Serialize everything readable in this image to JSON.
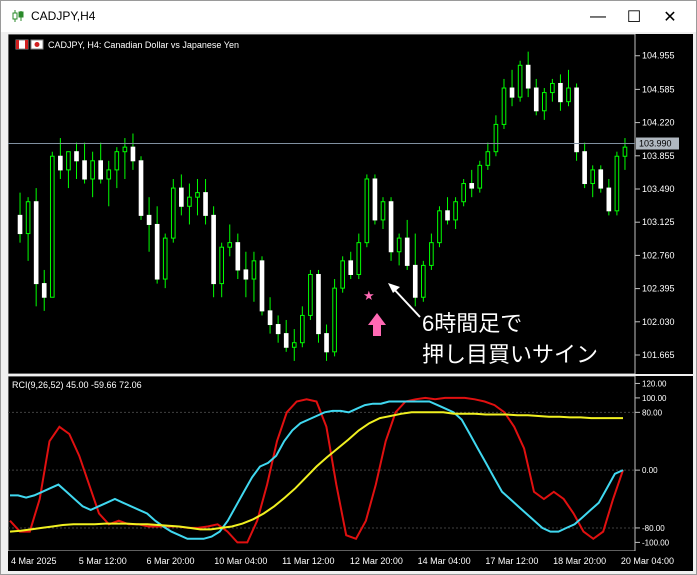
{
  "window": {
    "title": "CADJPY,H4",
    "buttons": {
      "minimize": "—",
      "maximize": "☐",
      "close": "✕"
    }
  },
  "main_chart": {
    "header": "CADJPY, H4:  Canadian Dollar vs Japanese Yen",
    "current_price": "103.990",
    "price_ticks": [
      "104.955",
      "104.585",
      "104.220",
      "103.855",
      "103.490",
      "103.125",
      "102.760",
      "102.395",
      "102.030",
      "101.665"
    ],
    "annotation_line1": "6時間足で",
    "annotation_line2": "押し目買いサイン",
    "marker_star": "★",
    "colors": {
      "candle_up": "#ffffff",
      "candle_down": "#ffffff",
      "wick": "#00ff00",
      "star": "#ff69b4",
      "arrow": "#ff69b4",
      "annotation_text": "#ffffff"
    }
  },
  "indicator": {
    "header": "RCI(9,26,52) 45.00 -59.66 72.06",
    "ticks": [
      "120.00",
      "100.00",
      "80.00",
      "0.00",
      "-80.00",
      "-100.00"
    ],
    "colors": {
      "short": "#e01010",
      "mid": "#40d8f0",
      "long": "#f0f020"
    }
  },
  "time_axis": {
    "labels": [
      "4 Mar 2025",
      "5 Mar 12:00",
      "6 Mar 20:00",
      "10 Mar 04:00",
      "11 Mar 12:00",
      "12 Mar 20:00",
      "14 Mar 04:00",
      "17 Mar 12:00",
      "18 Mar 20:00",
      "20 Mar 04:00"
    ]
  },
  "chart_data": [
    {
      "type": "candlestick",
      "title": "CADJPY, H4:  Canadian Dollar vs Japanese Yen",
      "ylim": [
        101.5,
        105.15
      ],
      "y_ticks": [
        104.955,
        104.585,
        104.22,
        103.855,
        103.49,
        103.125,
        102.76,
        102.395,
        102.03,
        101.665
      ],
      "current_price": 103.99,
      "ohlc": [
        [
          103.2,
          103.45,
          102.9,
          103.0
        ],
        [
          103.0,
          103.4,
          102.7,
          103.35
        ],
        [
          103.35,
          103.5,
          102.2,
          102.45
        ],
        [
          102.45,
          102.6,
          102.15,
          102.3
        ],
        [
          102.3,
          103.9,
          102.3,
          103.85
        ],
        [
          103.85,
          104.05,
          103.6,
          103.7
        ],
        [
          103.7,
          103.9,
          103.5,
          103.9
        ],
        [
          103.9,
          104.0,
          103.6,
          103.8
        ],
        [
          103.8,
          104.0,
          103.55,
          103.6
        ],
        [
          103.6,
          103.9,
          103.4,
          103.8
        ],
        [
          103.8,
          104.0,
          103.55,
          103.6
        ],
        [
          103.6,
          103.8,
          103.3,
          103.7
        ],
        [
          103.7,
          103.95,
          103.5,
          103.9
        ],
        [
          103.9,
          104.05,
          103.6,
          103.95
        ],
        [
          103.95,
          104.1,
          103.7,
          103.8
        ],
        [
          103.8,
          103.85,
          103.15,
          103.2
        ],
        [
          103.2,
          103.4,
          102.8,
          103.1
        ],
        [
          103.1,
          103.3,
          102.45,
          102.5
        ],
        [
          102.5,
          103.0,
          102.4,
          102.95
        ],
        [
          102.95,
          103.6,
          102.9,
          103.5
        ],
        [
          103.5,
          103.65,
          103.2,
          103.3
        ],
        [
          103.3,
          103.55,
          103.1,
          103.4
        ],
        [
          103.4,
          103.6,
          103.2,
          103.45
        ],
        [
          103.45,
          103.6,
          103.1,
          103.2
        ],
        [
          103.2,
          103.3,
          102.3,
          102.45
        ],
        [
          102.45,
          102.9,
          102.3,
          102.85
        ],
        [
          102.85,
          103.1,
          102.75,
          102.9
        ],
        [
          102.9,
          103.0,
          102.5,
          102.6
        ],
        [
          102.6,
          102.8,
          102.3,
          102.5
        ],
        [
          102.5,
          102.8,
          102.25,
          102.7
        ],
        [
          102.7,
          102.75,
          102.1,
          102.15
        ],
        [
          102.15,
          102.3,
          101.9,
          102.0
        ],
        [
          102.0,
          102.1,
          101.8,
          101.9
        ],
        [
          101.9,
          102.05,
          101.7,
          101.75
        ],
        [
          101.75,
          101.95,
          101.6,
          101.8
        ],
        [
          101.8,
          102.2,
          101.75,
          102.1
        ],
        [
          102.1,
          102.6,
          102.05,
          102.55
        ],
        [
          102.55,
          102.6,
          101.8,
          101.9
        ],
        [
          101.9,
          102.0,
          101.6,
          101.7
        ],
        [
          101.7,
          102.5,
          101.65,
          102.4
        ],
        [
          102.4,
          102.75,
          102.35,
          102.7
        ],
        [
          102.7,
          102.8,
          102.5,
          102.55
        ],
        [
          102.55,
          103.0,
          102.5,
          102.9
        ],
        [
          102.9,
          103.65,
          102.85,
          103.6
        ],
        [
          103.6,
          103.65,
          103.1,
          103.15
        ],
        [
          103.15,
          103.4,
          103.05,
          103.35
        ],
        [
          103.35,
          103.4,
          102.7,
          102.8
        ],
        [
          102.8,
          103.0,
          102.65,
          102.95
        ],
        [
          102.95,
          103.15,
          102.6,
          102.65
        ],
        [
          102.65,
          103.0,
          102.2,
          102.3
        ],
        [
          102.3,
          102.7,
          102.25,
          102.65
        ],
        [
          102.65,
          103.0,
          102.6,
          102.9
        ],
        [
          102.9,
          103.3,
          102.85,
          103.25
        ],
        [
          103.25,
          103.4,
          103.1,
          103.15
        ],
        [
          103.15,
          103.4,
          103.05,
          103.35
        ],
        [
          103.35,
          103.6,
          103.3,
          103.55
        ],
        [
          103.55,
          103.7,
          103.4,
          103.5
        ],
        [
          103.5,
          103.8,
          103.45,
          103.75
        ],
        [
          103.75,
          104.0,
          103.7,
          103.9
        ],
        [
          103.9,
          104.3,
          103.85,
          104.2
        ],
        [
          104.2,
          104.7,
          104.15,
          104.6
        ],
        [
          104.6,
          104.8,
          104.4,
          104.5
        ],
        [
          104.5,
          104.9,
          104.45,
          104.85
        ],
        [
          104.85,
          105.0,
          104.5,
          104.6
        ],
        [
          104.6,
          104.7,
          104.3,
          104.35
        ],
        [
          104.35,
          104.6,
          104.25,
          104.55
        ],
        [
          104.55,
          104.7,
          104.45,
          104.65
        ],
        [
          104.65,
          104.75,
          104.35,
          104.45
        ],
        [
          104.45,
          104.8,
          104.4,
          104.6
        ],
        [
          104.6,
          104.65,
          103.8,
          103.9
        ],
        [
          103.9,
          104.0,
          103.5,
          103.55
        ],
        [
          103.55,
          103.75,
          103.4,
          103.7
        ],
        [
          103.7,
          103.75,
          103.45,
          103.5
        ],
        [
          103.5,
          103.6,
          103.2,
          103.25
        ],
        [
          103.25,
          103.9,
          103.2,
          103.85
        ],
        [
          103.85,
          104.05,
          103.7,
          103.95
        ]
      ]
    },
    {
      "type": "line",
      "title": "RCI(9,26,52) 45.00 -59.66 72.06",
      "ylim": [
        -105,
        122
      ],
      "y_ticks": [
        120,
        100,
        80,
        0,
        -80,
        -100
      ],
      "series": [
        {
          "name": "RCI 9",
          "values": [
            -70,
            -85,
            -85,
            -40,
            40,
            60,
            50,
            20,
            -20,
            -60,
            -75,
            -70,
            -75,
            -75,
            -78,
            -78,
            -78,
            -78,
            -80,
            -80,
            -78,
            -75,
            -85,
            -100,
            -100,
            -70,
            -20,
            40,
            80,
            95,
            98,
            95,
            60,
            -20,
            -90,
            -95,
            -70,
            -20,
            40,
            80,
            95,
            98,
            100,
            98,
            100,
            100,
            100,
            98,
            95,
            90,
            80,
            60,
            30,
            -30,
            -40,
            -30,
            -40,
            -60,
            -85,
            -95,
            -85,
            -40,
            0
          ]
        },
        {
          "name": "RCI 26",
          "values": [
            -35,
            -35,
            -38,
            -35,
            -30,
            -25,
            -20,
            -30,
            -40,
            -50,
            -55,
            -50,
            -45,
            -40,
            -45,
            -50,
            -55,
            -60,
            -70,
            -78,
            -85,
            -90,
            -95,
            -95,
            -95,
            -92,
            -85,
            -70,
            -50,
            -30,
            -10,
            5,
            10,
            20,
            40,
            55,
            65,
            70,
            75,
            80,
            82,
            82,
            80,
            85,
            90,
            92,
            92,
            95,
            95,
            95,
            95,
            95,
            95,
            90,
            85,
            80,
            70,
            50,
            30,
            10,
            -10,
            -30,
            -40,
            -50,
            -60,
            -70,
            -80,
            -85,
            -85,
            -80,
            -75,
            -65,
            -55,
            -45,
            -25,
            -5,
            0
          ]
        },
        {
          "name": "RCI 52",
          "values": [
            -85,
            -84,
            -82,
            -80,
            -78,
            -76,
            -75,
            -75,
            -75,
            -74,
            -74,
            -74,
            -75,
            -75,
            -76,
            -77,
            -78,
            -80,
            -82,
            -82,
            -80,
            -78,
            -74,
            -68,
            -60,
            -50,
            -38,
            -25,
            -10,
            5,
            18,
            30,
            42,
            55,
            65,
            72,
            75,
            78,
            80,
            80,
            80,
            80,
            78,
            78,
            78,
            77,
            77,
            77,
            76,
            76,
            75,
            74,
            74,
            73,
            73,
            72,
            72,
            72,
            72
          ]
        }
      ]
    }
  ]
}
